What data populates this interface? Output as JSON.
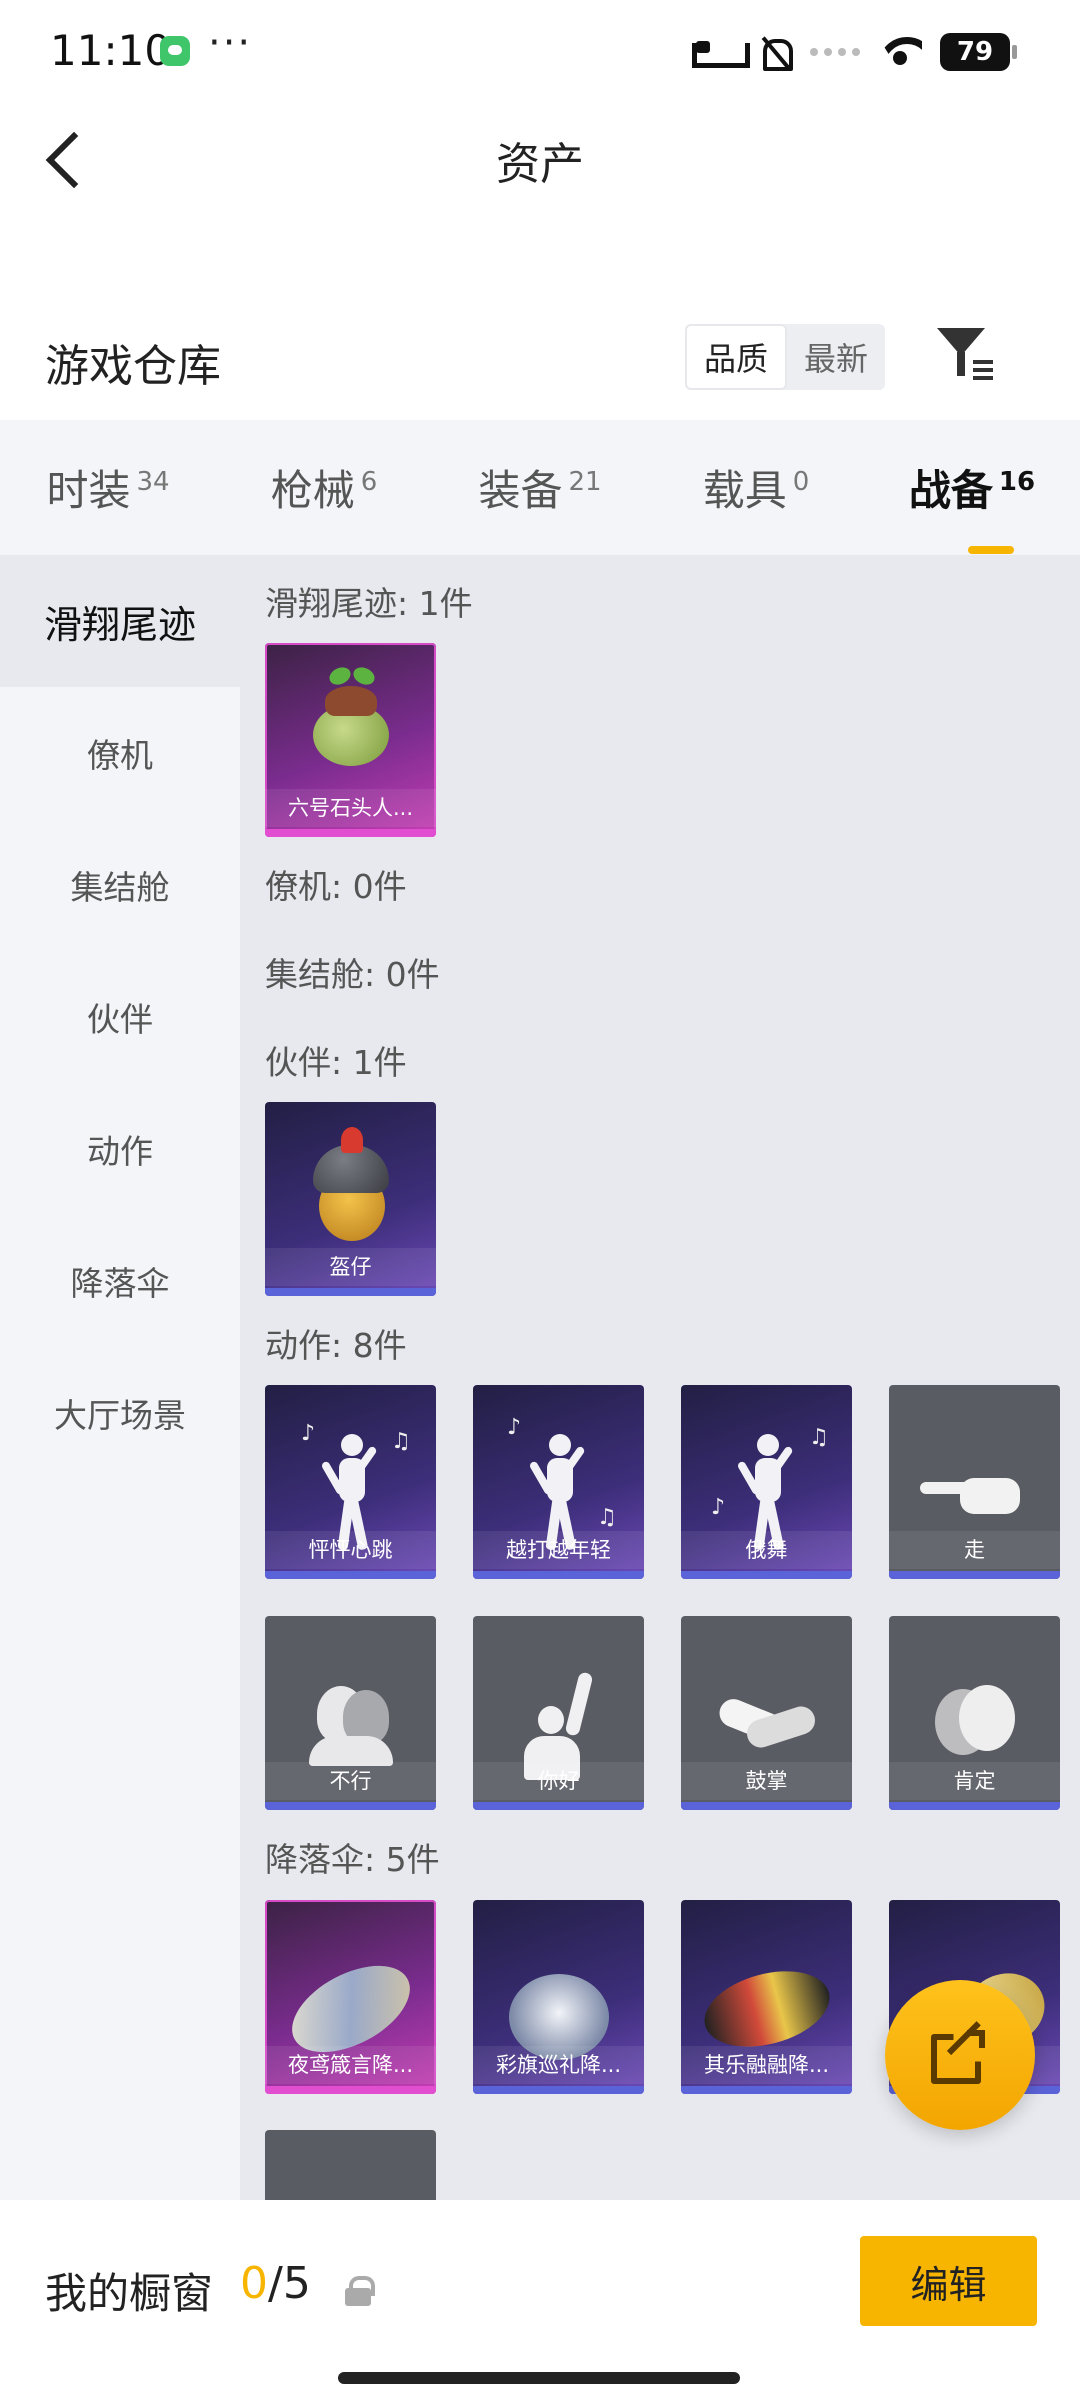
{
  "status_bar": {
    "time": "11:10",
    "dots": "···",
    "battery": "79"
  },
  "header": {
    "title": "资产"
  },
  "warehouse": {
    "title": "游戏仓库",
    "sort_options": [
      "品质",
      "最新"
    ],
    "active_sort": "品质"
  },
  "tabs": [
    {
      "label": "时装",
      "count": "34"
    },
    {
      "label": "枪械",
      "count": "6"
    },
    {
      "label": "装备",
      "count": "21"
    },
    {
      "label": "载具",
      "count": "0"
    },
    {
      "label": "战备",
      "count": "16",
      "active": true
    }
  ],
  "sidebar": {
    "items": [
      {
        "label": "滑翔尾迹",
        "active": true
      },
      {
        "label": "僚机"
      },
      {
        "label": "集结舱"
      },
      {
        "label": "伙伴"
      },
      {
        "label": "动作"
      },
      {
        "label": "降落伞"
      },
      {
        "label": "大厅场景"
      }
    ]
  },
  "sections": {
    "glide": {
      "title": "滑翔尾迹: 1件",
      "items": [
        {
          "label": "六号石头人...",
          "icon": "stone-creature-art"
        }
      ]
    },
    "wingman": {
      "title": "僚机: 0件"
    },
    "pod": {
      "title": "集结舱: 0件"
    },
    "partner": {
      "title": "伙伴: 1件",
      "items": [
        {
          "label": "盔仔",
          "icon": "helmet-chick-art"
        }
      ]
    },
    "emote": {
      "title": "动作: 8件",
      "items": [
        {
          "label": "怦怦心跳"
        },
        {
          "label": "越打越年轻"
        },
        {
          "label": "俄舞"
        },
        {
          "label": "走"
        },
        {
          "label": "不行"
        },
        {
          "label": "你好"
        },
        {
          "label": "鼓掌"
        },
        {
          "label": "肯定"
        }
      ]
    },
    "parachute": {
      "title": "降落伞: 5件",
      "items": [
        {
          "label": "夜鸢箴言降..."
        },
        {
          "label": "彩旗巡礼降..."
        },
        {
          "label": "其乐融融降..."
        },
        {
          "label": ""
        }
      ]
    }
  },
  "bottom": {
    "window_label": "我的橱窗",
    "window_current": "0",
    "window_total": "/5",
    "edit_label": "编辑"
  },
  "colors": {
    "accent": "#f7b500",
    "tabs_bg": "#f3f5f9",
    "content_bg": "#e7e9ee"
  }
}
